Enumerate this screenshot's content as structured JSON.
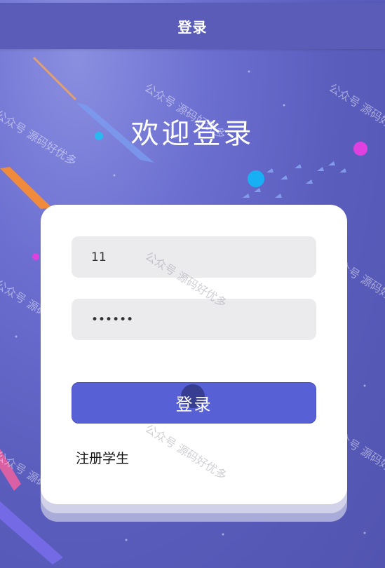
{
  "header": {
    "title": "登录"
  },
  "welcome": {
    "title": "欢迎登录"
  },
  "form": {
    "username_value": "11",
    "password_value": "••••••",
    "login_label": "登录",
    "register_label": "注册学生"
  },
  "watermark": {
    "text": "公众号 源码好优多"
  },
  "colors": {
    "header_bg": "#5a5cb8",
    "button_bg": "#5860d6",
    "field_bg": "#ebebed",
    "card_bg": "#ffffff"
  }
}
